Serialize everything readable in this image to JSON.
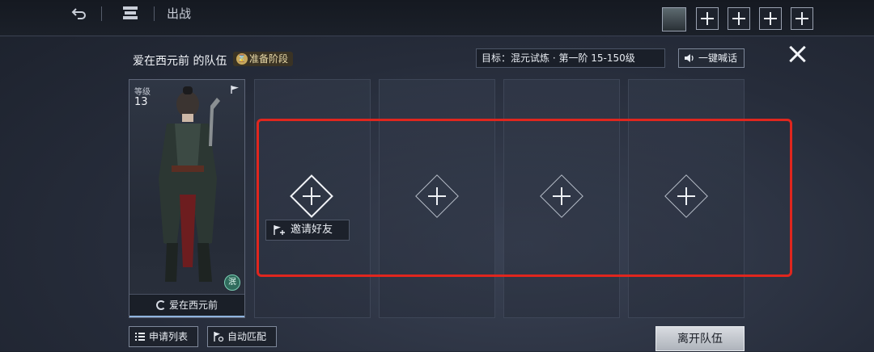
{
  "topbar": {
    "tab1_label": "出战",
    "slots": [
      "+",
      "+",
      "+",
      "+"
    ]
  },
  "team": {
    "title": "爱在西元前  的队伍",
    "stage_badge": "准备阶段",
    "target_text": "目标：混元试炼 · 第一阶   15-150级",
    "shout_label": "一键喊话"
  },
  "member": {
    "level_label": "等级",
    "level_value": "13",
    "emblem_char": "泯",
    "name": "爱在西元前"
  },
  "slots": {
    "invite_label": "邀请好友"
  },
  "bottom": {
    "apply_list_label": "申请列表",
    "auto_match_label": "自动匹配",
    "leave_label": "离开队伍"
  },
  "colors": {
    "highlight": "#e0261e",
    "background": "#262c3a",
    "badge": "#c9a95c"
  }
}
